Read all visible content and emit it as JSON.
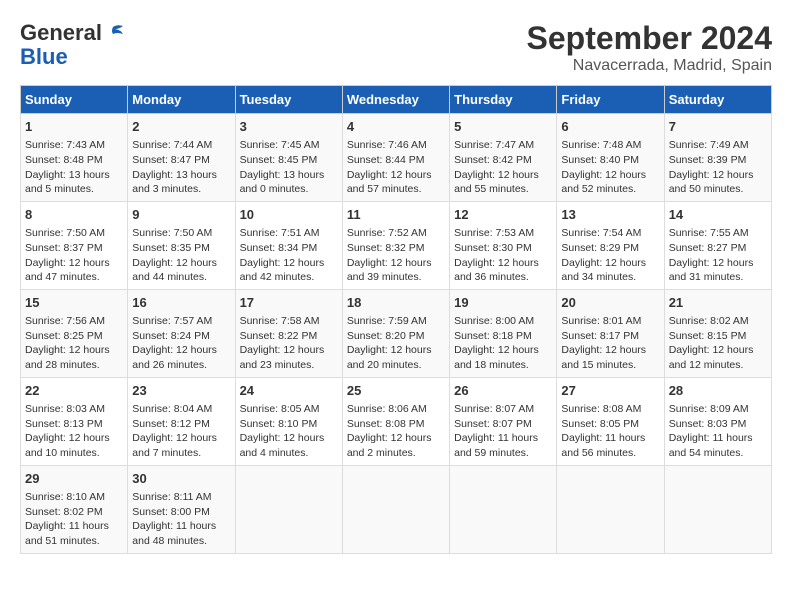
{
  "header": {
    "logo_general": "General",
    "logo_blue": "Blue",
    "month": "September 2024",
    "location": "Navacerrada, Madrid, Spain"
  },
  "days_of_week": [
    "Sunday",
    "Monday",
    "Tuesday",
    "Wednesday",
    "Thursday",
    "Friday",
    "Saturday"
  ],
  "weeks": [
    [
      {
        "day": "1",
        "info": "Sunrise: 7:43 AM\nSunset: 8:48 PM\nDaylight: 13 hours\nand 5 minutes."
      },
      {
        "day": "2",
        "info": "Sunrise: 7:44 AM\nSunset: 8:47 PM\nDaylight: 13 hours\nand 3 minutes."
      },
      {
        "day": "3",
        "info": "Sunrise: 7:45 AM\nSunset: 8:45 PM\nDaylight: 13 hours\nand 0 minutes."
      },
      {
        "day": "4",
        "info": "Sunrise: 7:46 AM\nSunset: 8:44 PM\nDaylight: 12 hours\nand 57 minutes."
      },
      {
        "day": "5",
        "info": "Sunrise: 7:47 AM\nSunset: 8:42 PM\nDaylight: 12 hours\nand 55 minutes."
      },
      {
        "day": "6",
        "info": "Sunrise: 7:48 AM\nSunset: 8:40 PM\nDaylight: 12 hours\nand 52 minutes."
      },
      {
        "day": "7",
        "info": "Sunrise: 7:49 AM\nSunset: 8:39 PM\nDaylight: 12 hours\nand 50 minutes."
      }
    ],
    [
      {
        "day": "8",
        "info": "Sunrise: 7:50 AM\nSunset: 8:37 PM\nDaylight: 12 hours\nand 47 minutes."
      },
      {
        "day": "9",
        "info": "Sunrise: 7:50 AM\nSunset: 8:35 PM\nDaylight: 12 hours\nand 44 minutes."
      },
      {
        "day": "10",
        "info": "Sunrise: 7:51 AM\nSunset: 8:34 PM\nDaylight: 12 hours\nand 42 minutes."
      },
      {
        "day": "11",
        "info": "Sunrise: 7:52 AM\nSunset: 8:32 PM\nDaylight: 12 hours\nand 39 minutes."
      },
      {
        "day": "12",
        "info": "Sunrise: 7:53 AM\nSunset: 8:30 PM\nDaylight: 12 hours\nand 36 minutes."
      },
      {
        "day": "13",
        "info": "Sunrise: 7:54 AM\nSunset: 8:29 PM\nDaylight: 12 hours\nand 34 minutes."
      },
      {
        "day": "14",
        "info": "Sunrise: 7:55 AM\nSunset: 8:27 PM\nDaylight: 12 hours\nand 31 minutes."
      }
    ],
    [
      {
        "day": "15",
        "info": "Sunrise: 7:56 AM\nSunset: 8:25 PM\nDaylight: 12 hours\nand 28 minutes."
      },
      {
        "day": "16",
        "info": "Sunrise: 7:57 AM\nSunset: 8:24 PM\nDaylight: 12 hours\nand 26 minutes."
      },
      {
        "day": "17",
        "info": "Sunrise: 7:58 AM\nSunset: 8:22 PM\nDaylight: 12 hours\nand 23 minutes."
      },
      {
        "day": "18",
        "info": "Sunrise: 7:59 AM\nSunset: 8:20 PM\nDaylight: 12 hours\nand 20 minutes."
      },
      {
        "day": "19",
        "info": "Sunrise: 8:00 AM\nSunset: 8:18 PM\nDaylight: 12 hours\nand 18 minutes."
      },
      {
        "day": "20",
        "info": "Sunrise: 8:01 AM\nSunset: 8:17 PM\nDaylight: 12 hours\nand 15 minutes."
      },
      {
        "day": "21",
        "info": "Sunrise: 8:02 AM\nSunset: 8:15 PM\nDaylight: 12 hours\nand 12 minutes."
      }
    ],
    [
      {
        "day": "22",
        "info": "Sunrise: 8:03 AM\nSunset: 8:13 PM\nDaylight: 12 hours\nand 10 minutes."
      },
      {
        "day": "23",
        "info": "Sunrise: 8:04 AM\nSunset: 8:12 PM\nDaylight: 12 hours\nand 7 minutes."
      },
      {
        "day": "24",
        "info": "Sunrise: 8:05 AM\nSunset: 8:10 PM\nDaylight: 12 hours\nand 4 minutes."
      },
      {
        "day": "25",
        "info": "Sunrise: 8:06 AM\nSunset: 8:08 PM\nDaylight: 12 hours\nand 2 minutes."
      },
      {
        "day": "26",
        "info": "Sunrise: 8:07 AM\nSunset: 8:07 PM\nDaylight: 11 hours\nand 59 minutes."
      },
      {
        "day": "27",
        "info": "Sunrise: 8:08 AM\nSunset: 8:05 PM\nDaylight: 11 hours\nand 56 minutes."
      },
      {
        "day": "28",
        "info": "Sunrise: 8:09 AM\nSunset: 8:03 PM\nDaylight: 11 hours\nand 54 minutes."
      }
    ],
    [
      {
        "day": "29",
        "info": "Sunrise: 8:10 AM\nSunset: 8:02 PM\nDaylight: 11 hours\nand 51 minutes."
      },
      {
        "day": "30",
        "info": "Sunrise: 8:11 AM\nSunset: 8:00 PM\nDaylight: 11 hours\nand 48 minutes."
      },
      {
        "day": "",
        "info": ""
      },
      {
        "day": "",
        "info": ""
      },
      {
        "day": "",
        "info": ""
      },
      {
        "day": "",
        "info": ""
      },
      {
        "day": "",
        "info": ""
      }
    ]
  ]
}
